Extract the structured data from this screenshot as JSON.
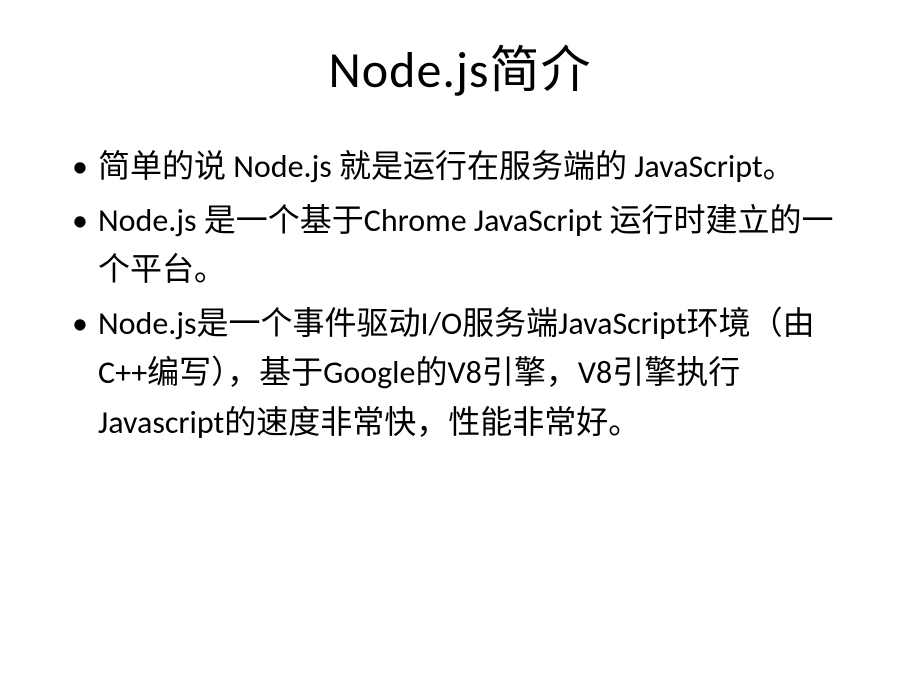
{
  "slide": {
    "title": "Node.js简介",
    "bullets": [
      "简单的说 Node.js 就是运行在服务端的 JavaScript。",
      "Node.js 是一个基于Chrome JavaScript 运行时建立的一个平台。",
      "Node.js是一个事件驱动I/O服务端JavaScript环境（由C++编写），基于Google的V8引擎，V8引擎执行Javascript的速度非常快，性能非常好。"
    ]
  }
}
